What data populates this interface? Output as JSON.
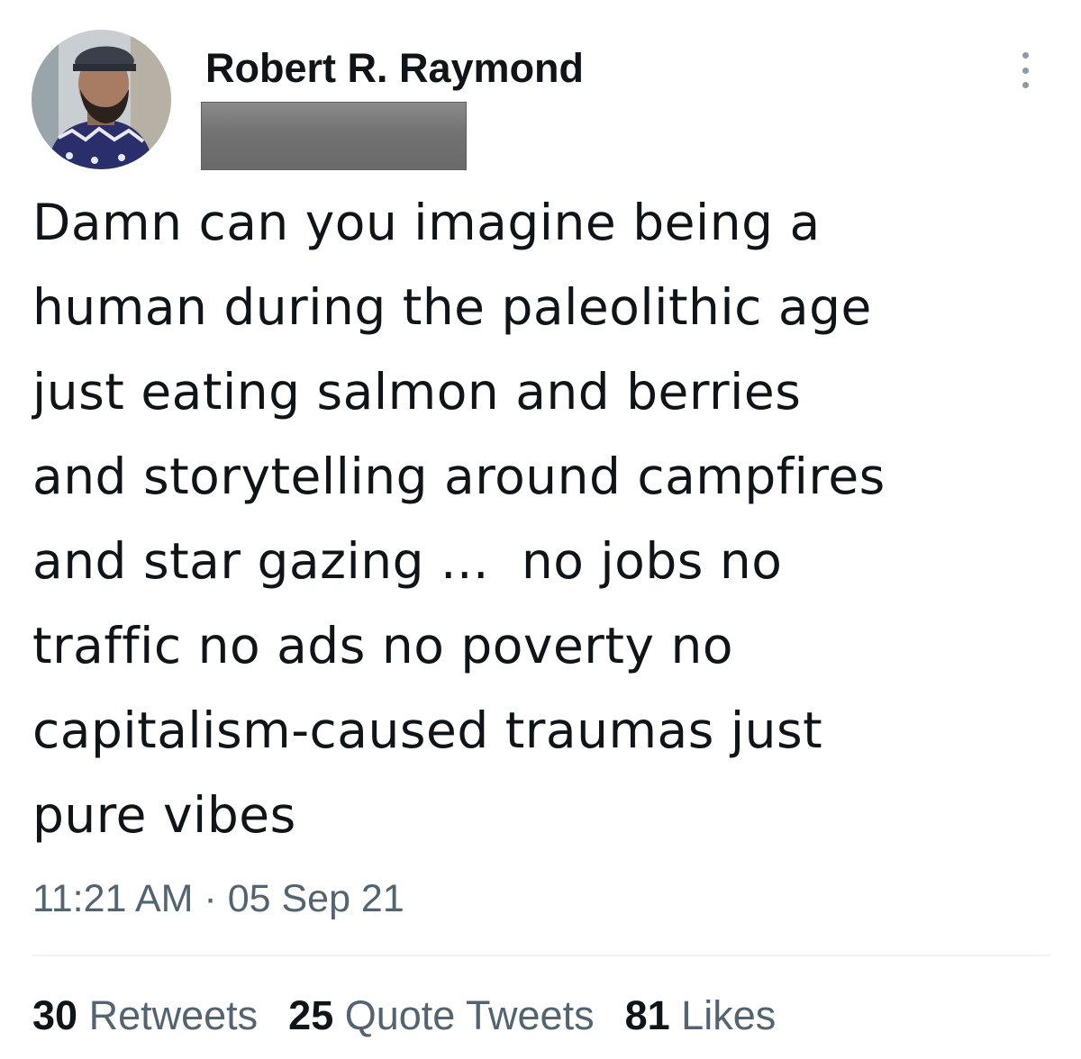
{
  "author": {
    "display_name": "Robert R. Raymond",
    "avatar": "profile-photo",
    "more_icon": "more-options-icon"
  },
  "tweet": {
    "lines": [
      "Damn can you imagine being a",
      "human during the paleolithic age",
      "just eating salmon and berries",
      "and storytelling around campfires",
      "and star gazing ...  no jobs no",
      "traffic no ads no poverty no",
      "capitalism-caused traumas just",
      "pure vibes"
    ],
    "timestamp": "11:21 AM · 05 Sep 21"
  },
  "stats": {
    "retweets_count": "30",
    "retweets_label": "Retweets",
    "quotes_count": "25",
    "quotes_label": "Quote Tweets",
    "likes_count": "81",
    "likes_label": "Likes"
  },
  "colors": {
    "text_primary": "#0f1419",
    "text_secondary": "#536471",
    "divider": "#eff3f4",
    "redaction": "#727272"
  }
}
